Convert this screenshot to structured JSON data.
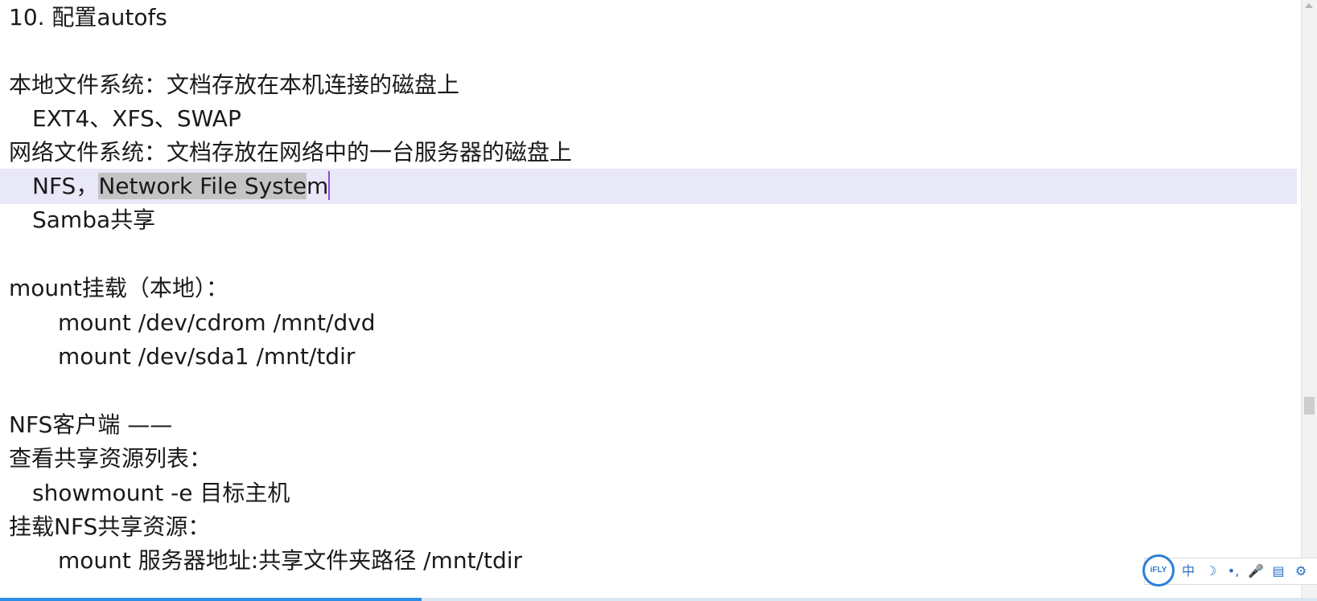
{
  "document": {
    "lines": [
      "10. 配置autofs",
      "",
      "本地文件系统：文档存放在本机连接的磁盘上",
      "EXT4、XFS、SWAP",
      "网络文件系统：文档存放在网络中的一台服务器的磁盘上",
      {
        "plain": "NFS，",
        "selected": "Network File Syste",
        "after": "m"
      },
      "Samba共享",
      "",
      "mount挂载（本地）：",
      "mount /dev/cdrom /mnt/dvd",
      "mount /dev/sda1 /mnt/tdir",
      "",
      "NFS客户端 ——",
      "查看共享资源列表：",
      "showmount -e 目标主机",
      "挂载NFS共享资源：",
      "mount 服务器地址:共享文件夹路径 /mnt/tdir"
    ]
  },
  "overlay": {
    "play_icon": "play-icon"
  },
  "ime": {
    "logo": "iFLY",
    "items": [
      "中",
      "☽",
      "•,",
      "🎤",
      "▤",
      "⚙"
    ]
  },
  "progress": {
    "fraction": 0.32
  },
  "colors": {
    "selection": "#c4c4c4",
    "cursor_line": "#e8e8f8",
    "caret": "#8a4bd6",
    "progress": "#2f8de4",
    "ime_accent": "#2b7fd6"
  }
}
